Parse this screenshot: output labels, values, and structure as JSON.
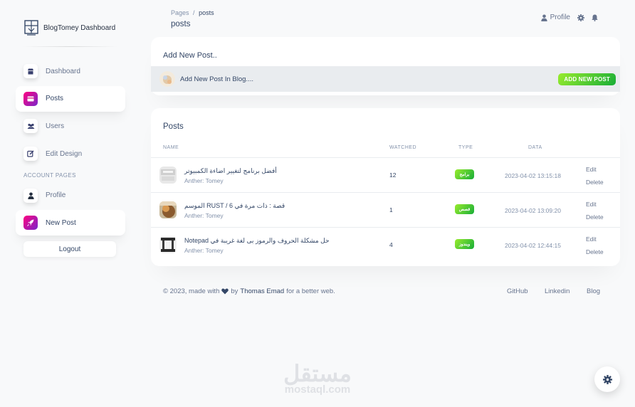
{
  "brand": {
    "name": "BlogTomey Dashboard"
  },
  "sidebar": {
    "items": [
      {
        "label": "Dashboard",
        "icon": "shop-icon"
      },
      {
        "label": "Posts",
        "icon": "card-icon"
      },
      {
        "label": "Users",
        "icon": "users-icon"
      },
      {
        "label": "Edit Design",
        "icon": "edit-icon"
      }
    ],
    "section_title": "ACCOUNT PAGES",
    "account_items": [
      {
        "label": "Profile",
        "icon": "user-icon"
      },
      {
        "label": "New Post",
        "icon": "rocket-icon"
      }
    ],
    "logout_label": "Logout",
    "active": [
      "Posts",
      "New Post"
    ]
  },
  "topbar": {
    "breadcrumb_root": "Pages",
    "breadcrumb_sep": "/",
    "breadcrumb_current": "posts",
    "page_title": "posts",
    "profile_label": "Profile"
  },
  "new_post_card": {
    "title": "Add New Post..",
    "prompt": "Add New Post In Blog....",
    "button_label": "ADD NEW POST"
  },
  "posts_card": {
    "title": "Posts",
    "columns": [
      "NAME",
      "WATCHED",
      "TYPE",
      "DATA"
    ],
    "rows": [
      {
        "title": "أفضل برنامج لتغيير اضاءة الكمبيوتر",
        "author": "Anther: Tomey",
        "watched": "12",
        "type": "برامج",
        "date": "2023-04-02 13:15:18",
        "edit": "Edit",
        "delete": "Delete"
      },
      {
        "title": "قصة : ذات مرة في RUST / 6 الموسم",
        "author": "Anther: Tomey",
        "watched": "1",
        "type": "قصص",
        "date": "2023-04-02 13:09:20",
        "edit": "Edit",
        "delete": "Delete"
      },
      {
        "title": "حل مشكلة الحروف والرموز بى لغة غريبة في Notepad",
        "author": "Anther: Tomey",
        "watched": "4",
        "type": "ويندوز",
        "date": "2023-04-02 12:44:15",
        "edit": "Edit",
        "delete": "Delete"
      }
    ]
  },
  "footer": {
    "prefix": "© 2023, made with",
    "by": "by",
    "author": "Thomas Emad",
    "suffix": "for a better web.",
    "links": [
      "GitHub",
      "Linkedin",
      "Blog"
    ]
  },
  "watermark": {
    "logo": "مستقل",
    "site": "mostaql.com"
  },
  "colors": {
    "accent_gradient_start": "#7928ca",
    "accent_gradient_end": "#ff0080",
    "success_start": "#17ad37",
    "success_end": "#98ec2d",
    "text": "#344767",
    "muted": "#8392ab"
  }
}
